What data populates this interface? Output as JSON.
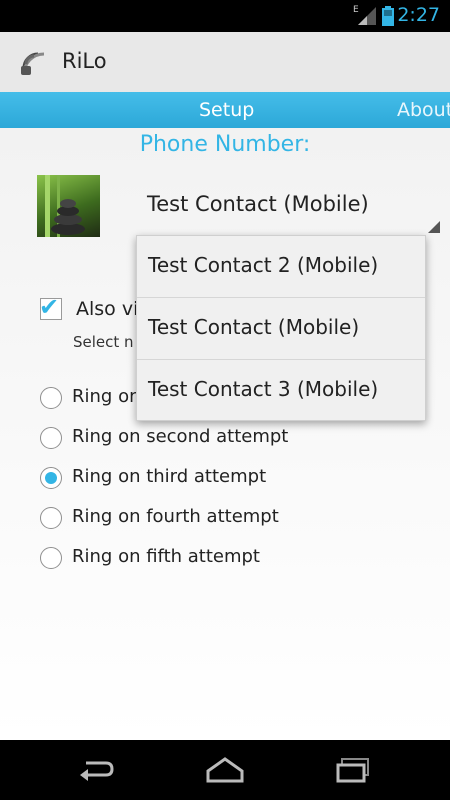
{
  "status_bar": {
    "network_label": "E",
    "time": "2:27",
    "icons": [
      "signal-icon",
      "battery-icon"
    ]
  },
  "action_bar": {
    "app_title": "RiLo",
    "icon": "wifi-rss-icon"
  },
  "tabs": [
    {
      "label": "Setup",
      "selected": true
    },
    {
      "label": "About",
      "selected": false
    }
  ],
  "main": {
    "phone_heading": "Phone Number:",
    "selected_contact": "Test Contact (Mobile)",
    "vibrate_label": "Also vi",
    "select_hint": "Select n",
    "ring_options": [
      {
        "label": "Ring on",
        "selected": false
      },
      {
        "label": "Ring on second attempt",
        "selected": false
      },
      {
        "label": "Ring on third attempt",
        "selected": true
      },
      {
        "label": "Ring on fourth attempt",
        "selected": false
      },
      {
        "label": "Ring on fifth attempt",
        "selected": false
      }
    ]
  },
  "dropdown": {
    "options": [
      "Test Contact 2 (Mobile)",
      "Test Contact (Mobile)",
      "Test Contact 3 (Mobile)"
    ]
  },
  "nav_bar": {
    "icons": [
      "back-icon",
      "home-icon",
      "recents-icon"
    ]
  },
  "colors": {
    "accent": "#33b5e5",
    "tab_bar": "#2ca8d8",
    "status_bar": "#000000"
  }
}
